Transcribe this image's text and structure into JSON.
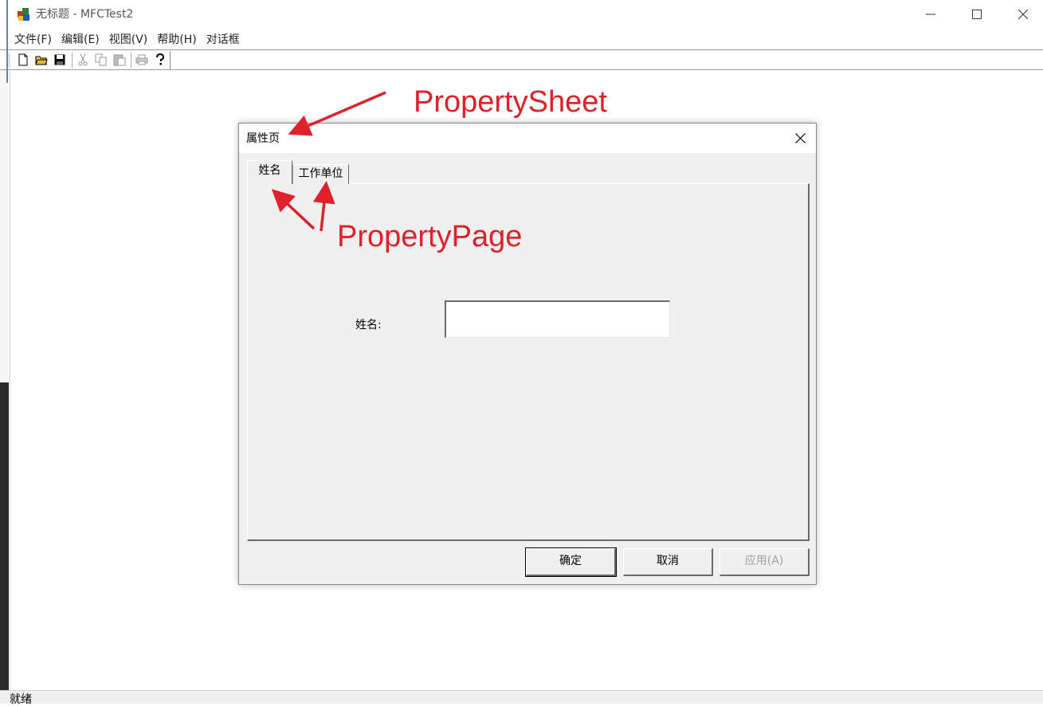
{
  "window": {
    "title": "无标题 - MFCTest2",
    "controls": {
      "minimize": "minimize-icon",
      "maximize": "maximize-icon",
      "close": "close-icon"
    }
  },
  "menu": {
    "items": [
      {
        "label": "文件(F)"
      },
      {
        "label": "编辑(E)"
      },
      {
        "label": "视图(V)"
      },
      {
        "label": "帮助(H)"
      },
      {
        "label": "对话框"
      }
    ]
  },
  "toolbar": {
    "buttons": [
      "new-file-icon",
      "open-folder-icon",
      "save-icon",
      "cut-icon",
      "copy-icon",
      "paste-icon",
      "print-icon",
      "help-icon"
    ]
  },
  "status": {
    "text": "就绪"
  },
  "dialog": {
    "title": "属性页",
    "tabs": [
      {
        "label": "姓名",
        "active": true
      },
      {
        "label": "工作单位",
        "active": false
      }
    ],
    "page": {
      "field_label": "姓名:",
      "field_value": ""
    },
    "buttons": {
      "ok": "确定",
      "cancel": "取消",
      "apply": "应用(A)"
    }
  },
  "annotations": {
    "color": "#e0202a",
    "sheet_label": "PropertySheet",
    "page_label": "PropertyPage"
  },
  "colors": {
    "dialog_bg": "#f0f0f0",
    "annotation": "#e0202a"
  }
}
